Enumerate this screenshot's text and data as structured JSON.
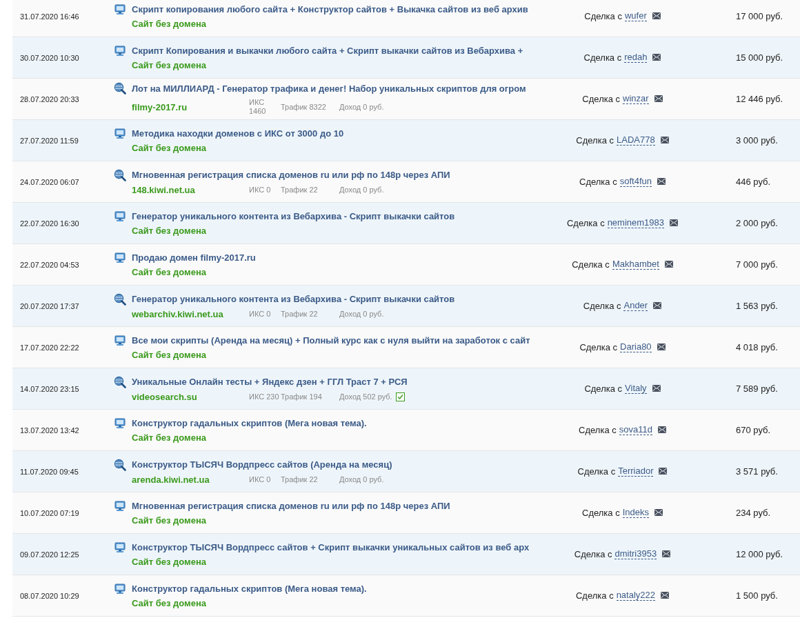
{
  "deals": [
    {
      "date": "31.07.2020 16:46",
      "kind": "script",
      "title": "Скрипт копирования любого сайта + Конструктор сайтов + Выкачка сайтов из веб архив",
      "domain": "Сайт без домена",
      "deal_label": "Сделка с",
      "buyer": "wufer",
      "price": "17 000 руб."
    },
    {
      "date": "30.07.2020 10:30",
      "kind": "script",
      "title": "Скрипт Копирования и выкачки любого сайта + Скрипт выкачки сайтов из Вебархива +",
      "domain": "Сайт без домена",
      "deal_label": "Сделка с",
      "buyer": "redah",
      "price": "15 000 руб."
    },
    {
      "date": "28.07.2020 20:33",
      "kind": "site",
      "title": "Лот на МИЛЛИАРД - Генератор трафика и денег! Набор уникальных скриптов для огром",
      "domain": "filmy-2017.ru",
      "iks": "ИКС 1460",
      "traffic": "Трафик 8322",
      "income": "Доход 0 руб.",
      "verified": false,
      "deal_label": "Сделка с",
      "buyer": "winzar",
      "price": "12 446 руб."
    },
    {
      "date": "27.07.2020 11:59",
      "kind": "script",
      "title": "Методика находки доменов с ИКС от 3000 до 10",
      "domain": "Сайт без домена",
      "deal_label": "Сделка с",
      "buyer": "LADA778",
      "price": "3 000 руб."
    },
    {
      "date": "24.07.2020 06:07",
      "kind": "site",
      "title": "Мгновенная регистрация списка доменов ru или рф по 148р через АПИ",
      "domain": "148.kiwi.net.ua",
      "iks": "ИКС 0",
      "traffic": "Трафик 22",
      "income": "Доход 0 руб.",
      "verified": false,
      "deal_label": "Сделка с",
      "buyer": "soft4fun",
      "price": "446 руб."
    },
    {
      "date": "22.07.2020 16:30",
      "kind": "script",
      "title": "Генератор уникального контента из Вебархива - Скрипт выкачки сайтов",
      "domain": "Сайт без домена",
      "deal_label": "Сделка с",
      "buyer": "neminem1983",
      "price": "2 000 руб."
    },
    {
      "date": "22.07.2020 04:53",
      "kind": "script",
      "title": "Продаю домен filmy-2017.ru",
      "domain": "Сайт без домена",
      "deal_label": "Сделка с",
      "buyer": "Makhambet",
      "price": "7 000 руб."
    },
    {
      "date": "20.07.2020 17:37",
      "kind": "site",
      "title": "Генератор уникального контента из Вебархива - Скрипт выкачки сайтов",
      "domain": "webarchiv.kiwi.net.ua",
      "iks": "ИКС 0",
      "traffic": "Трафик 22",
      "income": "Доход 0 руб.",
      "verified": false,
      "deal_label": "Сделка с",
      "buyer": "Ander",
      "price": "1 563 руб."
    },
    {
      "date": "17.07.2020 22:22",
      "kind": "script",
      "title": "Все мои скрипты (Аренда на месяц) + Полный курс как с нуля выйти на заработок с сайт",
      "domain": "Сайт без домена",
      "deal_label": "Сделка с",
      "buyer": "Daria80",
      "price": "4 018 руб."
    },
    {
      "date": "14.07.2020 23:15",
      "kind": "site",
      "title": "Уникальные Онлайн тесты + Яндекс дзен + ГГЛ Траст 7 + РСЯ",
      "domain": "videosearch.su",
      "iks": "ИКС 230",
      "traffic": "Трафик 194",
      "income": "Доход 502 руб.",
      "verified": true,
      "deal_label": "Сделка с",
      "buyer": "Vitaly",
      "price": "7 589 руб."
    },
    {
      "date": "13.07.2020 13:42",
      "kind": "script",
      "title": "Конструктор гадальных скриптов (Мега новая тема).",
      "domain": "Сайт без домена",
      "deal_label": "Сделка с",
      "buyer": "sova11d",
      "price": "670 руб."
    },
    {
      "date": "11.07.2020 09:45",
      "kind": "site",
      "title": "Конструктор ТЫСЯЧ Вордпресс сайтов (Аренда на месяц)",
      "domain": "arenda.kiwi.net.ua",
      "iks": "ИКС 0",
      "traffic": "Трафик 22",
      "income": "Доход 0 руб.",
      "verified": false,
      "deal_label": "Сделка с",
      "buyer": "Terriador",
      "price": "3 571 руб."
    },
    {
      "date": "10.07.2020 07:19",
      "kind": "script",
      "title": "Мгновенная регистрация списка доменов ru или рф по 148р через АПИ",
      "domain": "Сайт без домена",
      "deal_label": "Сделка с",
      "buyer": "Indeks",
      "price": "234 руб."
    },
    {
      "date": "09.07.2020 12:25",
      "kind": "script",
      "title": "Конструктор ТЫСЯЧ Вордпресс сайтов + Скрипт выкачки уникальных сайтов из веб арх",
      "domain": "Сайт без домена",
      "deal_label": "Сделка с",
      "buyer": "dmitri3953",
      "price": "12 000 руб."
    },
    {
      "date": "08.07.2020 10:29",
      "kind": "script",
      "title": "Конструктор гадальных скриптов (Мега новая тема).",
      "domain": "Сайт без домена",
      "deal_label": "Сделка с",
      "buyer": "nataly222",
      "price": "1 500 руб."
    }
  ]
}
